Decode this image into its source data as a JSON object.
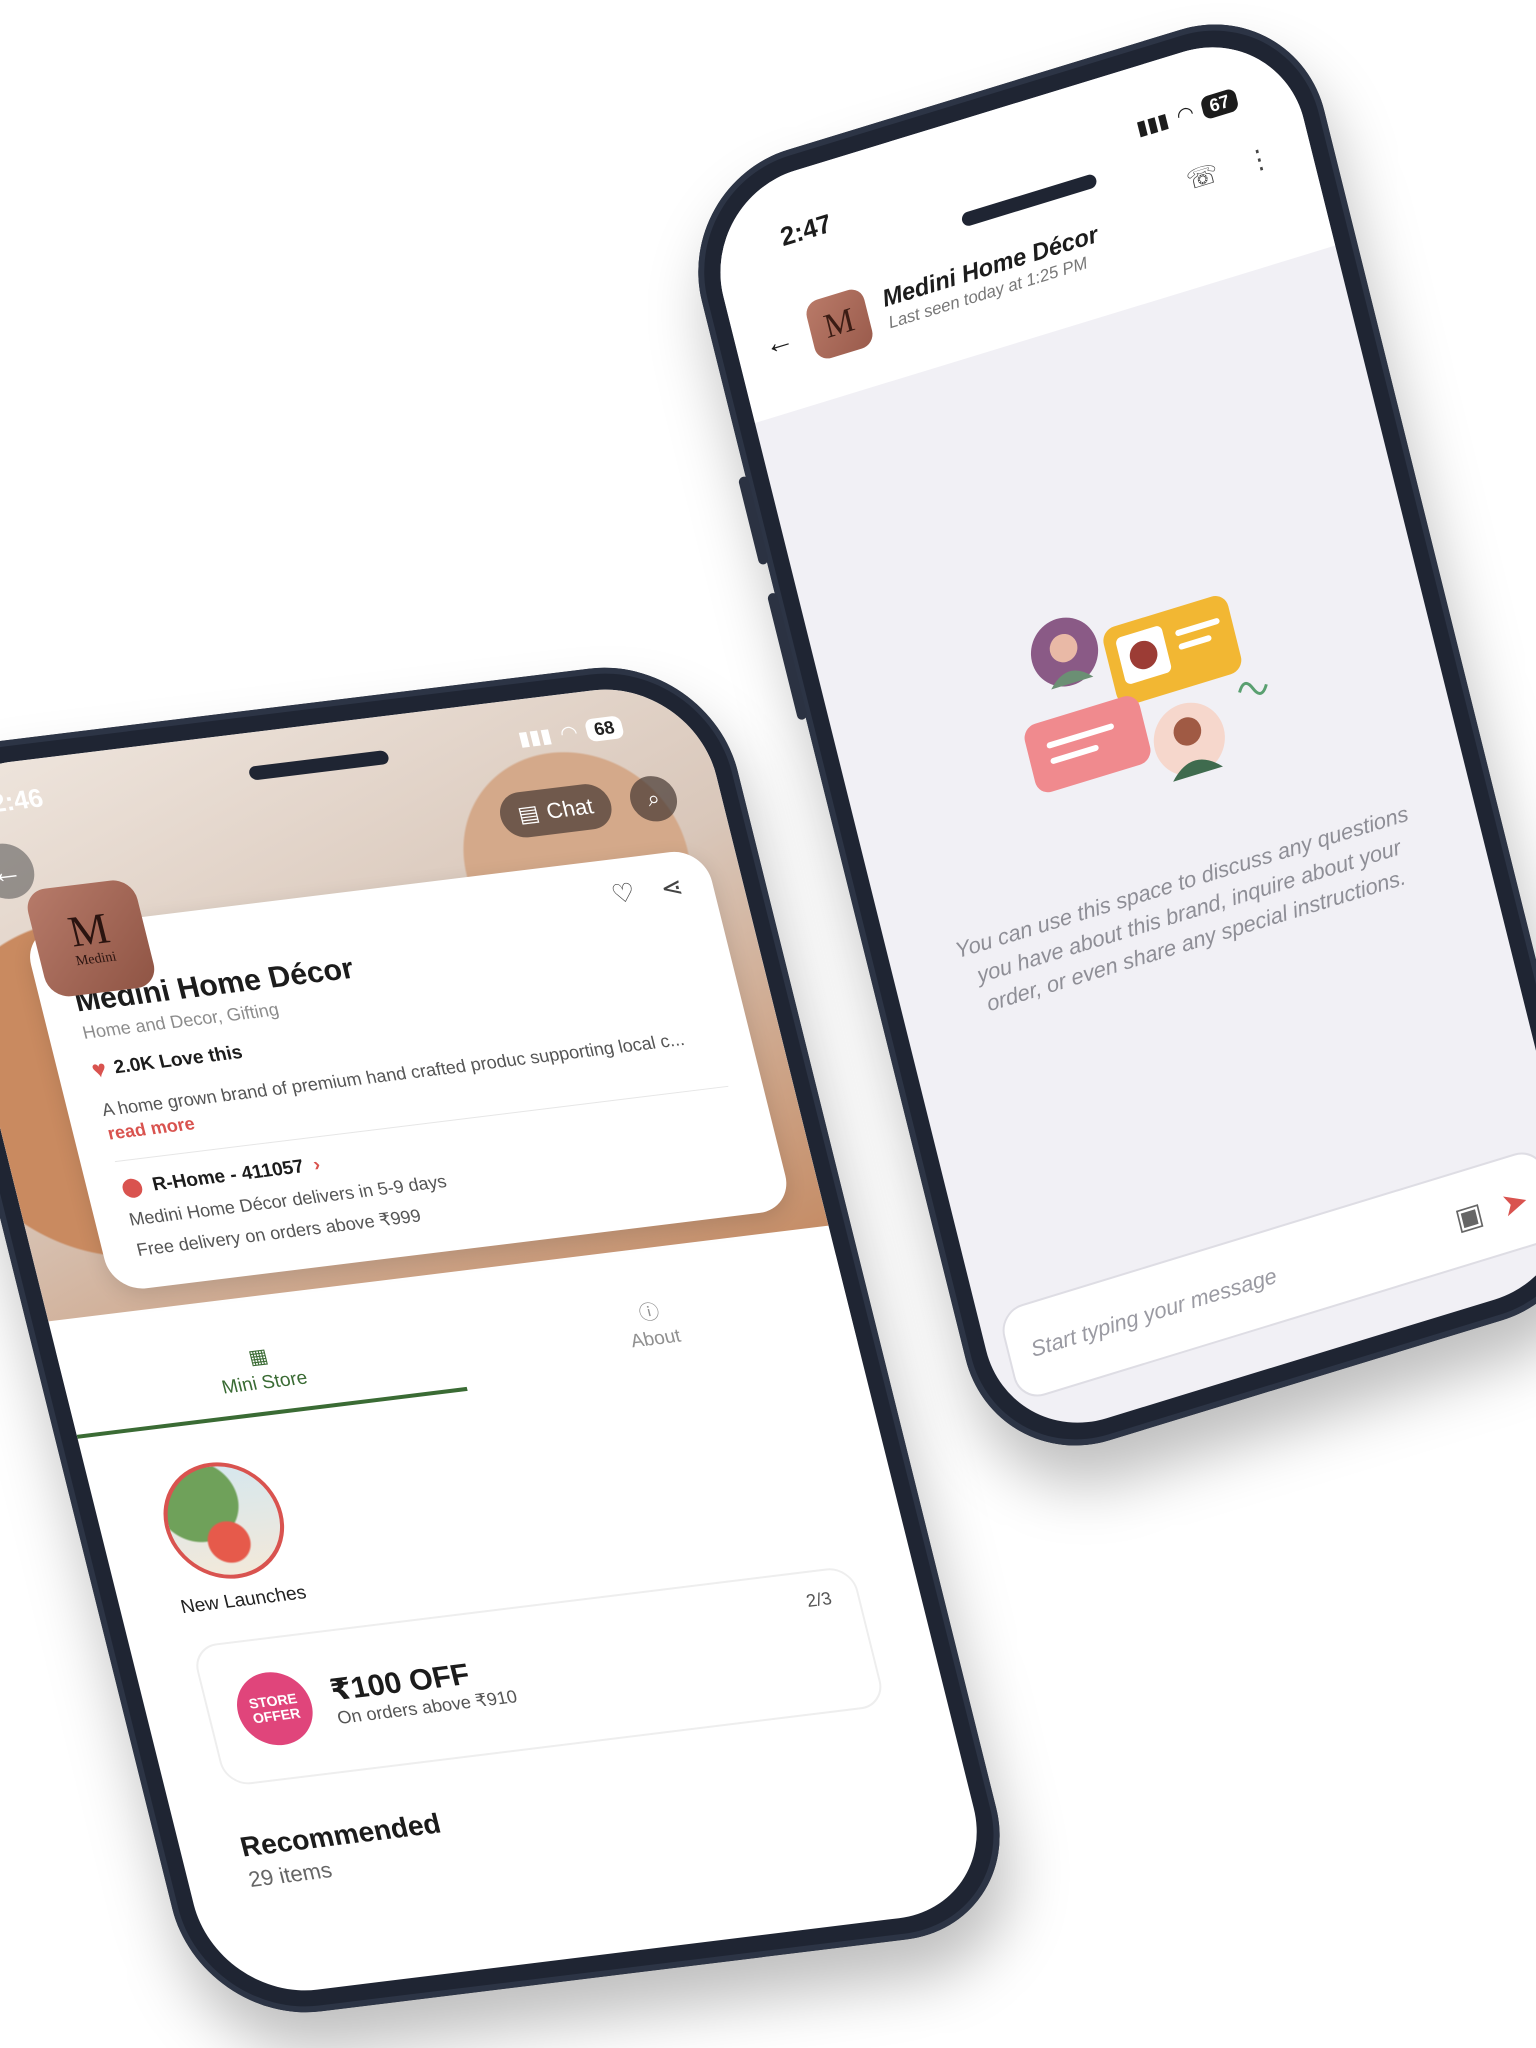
{
  "chat": {
    "time": "2:47",
    "battery": "67",
    "title": "Medini Home Décor",
    "last_seen": "Last seen today at 1:25 PM",
    "avatar_letter": "M",
    "empty_message": "You can use this space to discuss any questions you have about this brand, inquire about your order, or even share any special instructions.",
    "composer_placeholder": "Start typing your message",
    "icons": [
      "back-arrow-icon",
      "call-icon",
      "more-vertical-icon",
      "image-icon",
      "send-icon"
    ]
  },
  "store": {
    "time": "2:46",
    "battery": "68",
    "chat_label": "Chat",
    "logo_letter": "M",
    "logo_word": "Medini",
    "name": "Medini Home Décor",
    "category": "Home and Decor, Gifting",
    "love_count": "2.0K Love this",
    "description": "A home grown brand of premium hand crafted produc supporting local c...",
    "read_more": "read more",
    "location": "R-Home - 411057",
    "delivery_time": "Medini Home Décor delivers in 5-9 days",
    "free_delivery": "Free delivery on orders above ₹999",
    "tabs": [
      {
        "label": "Mini Store",
        "active": true
      },
      {
        "label": "About",
        "active": false
      }
    ],
    "story_label": "New Launches",
    "offer": {
      "badge": "STORE OFFER",
      "title": "₹100 OFF",
      "subtitle": "On orders above ₹910",
      "pager": "2/3"
    },
    "recommended_title": "Recommended",
    "recommended_count": "29 items"
  },
  "colors": {
    "accent_red": "#d9534f",
    "accent_green": "#3a6b34",
    "offer_pink": "#e0457b",
    "phone_frame": "#1f2533"
  }
}
